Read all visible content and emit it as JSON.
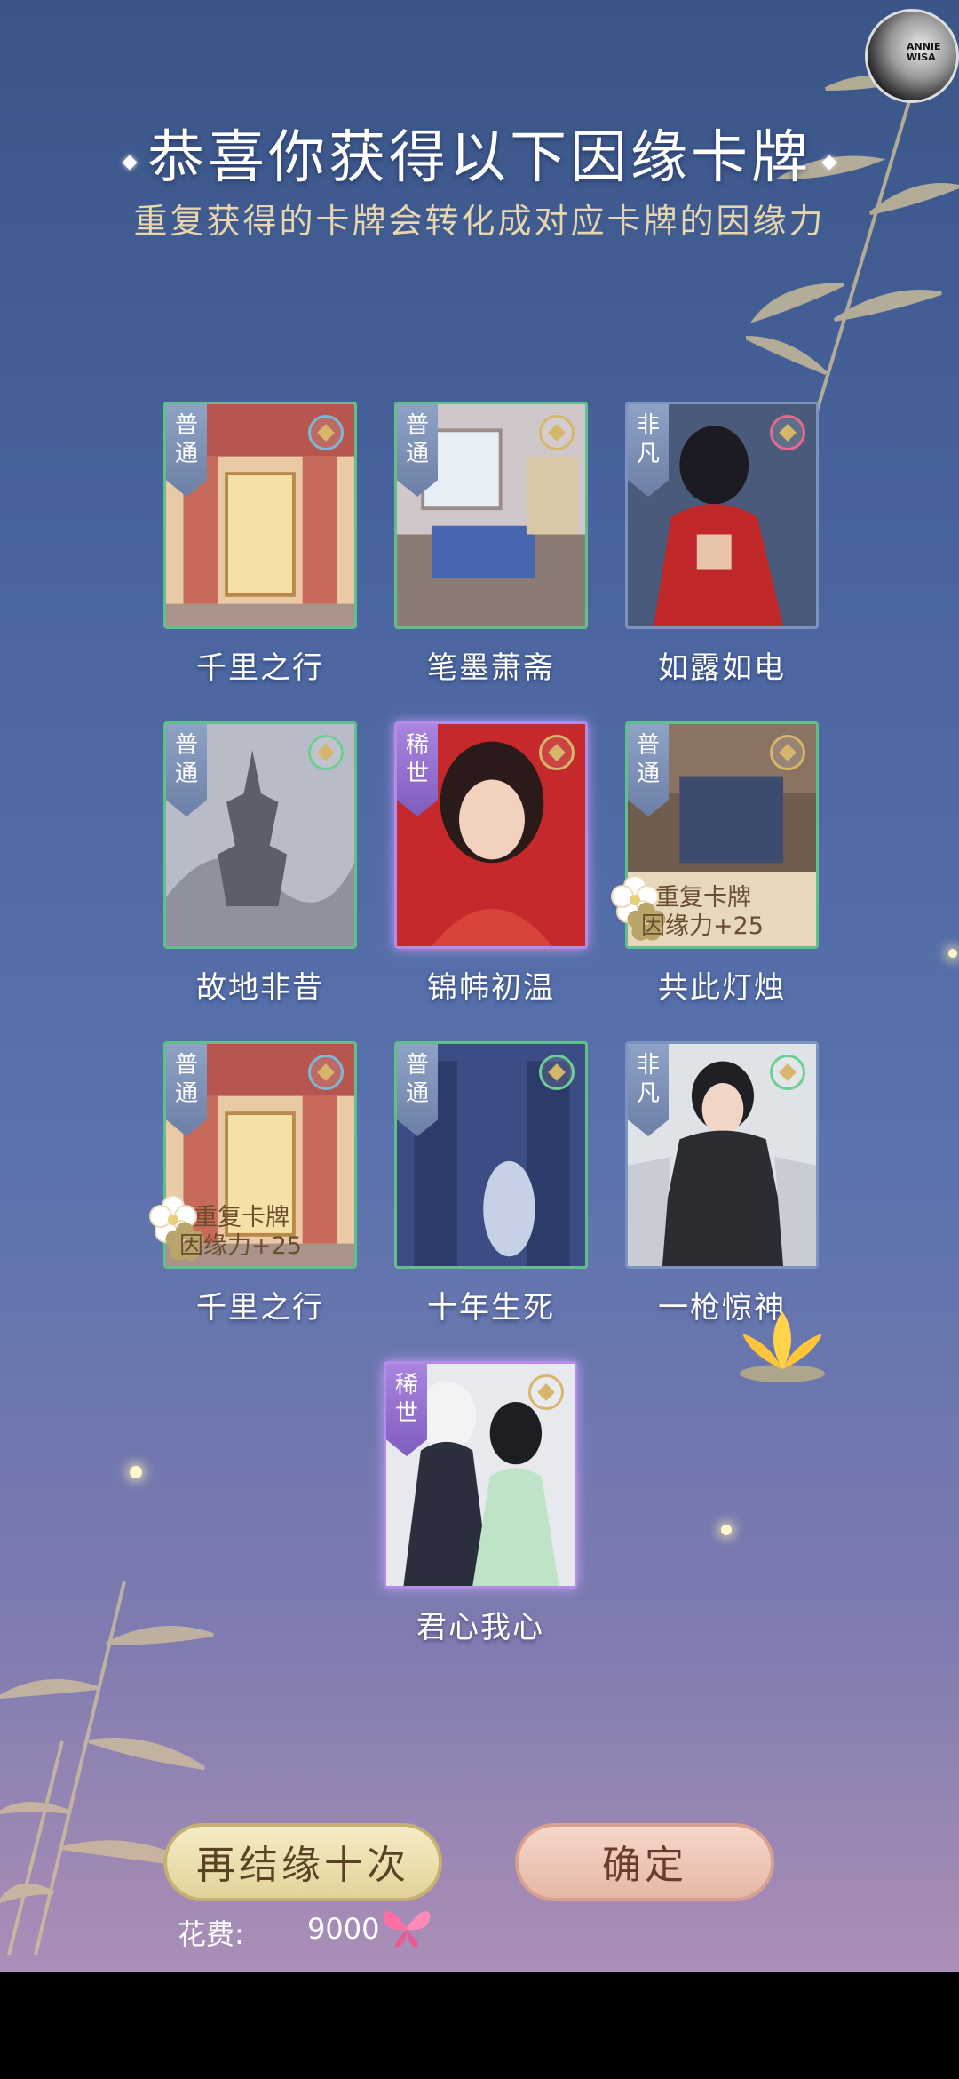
{
  "header": {
    "title": "恭喜你获得以下因缘卡牌",
    "subtitle": "重复获得的卡牌会转化成对应卡牌的因缘力"
  },
  "avatar": {
    "text_line1": "ANNIE",
    "text_line2": "WISA"
  },
  "cards": [
    {
      "name": "千里之行",
      "rarity": "普通",
      "duplicate": false
    },
    {
      "name": "笔墨萧斋",
      "rarity": "普通",
      "duplicate": false
    },
    {
      "name": "如露如电",
      "rarity": "非凡",
      "duplicate": false
    },
    {
      "name": "故地非昔",
      "rarity": "普通",
      "duplicate": false
    },
    {
      "name": "锦帏初温",
      "rarity": "稀世",
      "duplicate": false
    },
    {
      "name": "共此灯烛",
      "rarity": "普通",
      "duplicate": true,
      "dup_line1": "重复卡牌",
      "dup_line2": "因缘力+25"
    },
    {
      "name": "千里之行",
      "rarity": "普通",
      "duplicate": true,
      "dup_line1": "重复卡牌",
      "dup_line2": "因缘力+25"
    },
    {
      "name": "十年生死",
      "rarity": "普通",
      "duplicate": false
    },
    {
      "name": "一枪惊神",
      "rarity": "非凡",
      "duplicate": false
    },
    {
      "name": "君心我心",
      "rarity": "稀世",
      "duplicate": false
    }
  ],
  "buttons": {
    "retry_label": "再结缘十次",
    "ok_label": "确定"
  },
  "cost": {
    "label": "花费:",
    "value": "9000",
    "icon": "butterfly-icon"
  },
  "colors": {
    "common_border": "#5fc08a",
    "rare_border": "#b58be8",
    "gold": "#d6b66a"
  }
}
